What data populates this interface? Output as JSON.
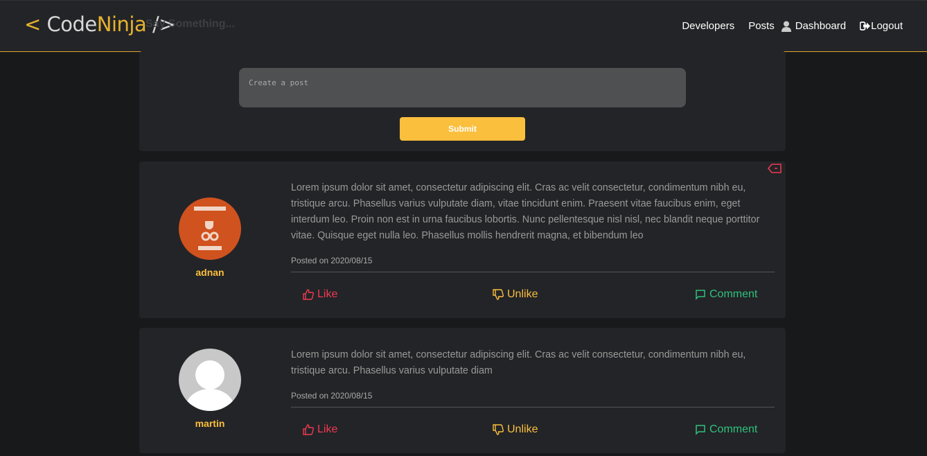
{
  "nav": {
    "logo_open": "< ",
    "logo_code": "Code",
    "logo_ninja": "Ninja",
    "logo_close": " />",
    "tagline": "Say Something...",
    "links": [
      "Developers",
      "Posts",
      "Dashboard",
      "Logout"
    ]
  },
  "create": {
    "placeholder": "Create a post",
    "submit": "Submit"
  },
  "colors": {
    "accent": "#fbbf3e",
    "like": "#f03a54",
    "comment": "#2ec27e"
  },
  "posts": [
    {
      "user": "adnan",
      "avatar": "programmer-code-badge",
      "text": "Lorem ipsum dolor sit amet, consectetur adipiscing elit. Cras ac velit consectetur, condimentum nibh eu, tristique arcu. Phasellus varius vulputate diam, vitae tincidunt enim. Praesent vitae faucibus enim, eget interdum leo. Proin non est in urna faucibus lobortis. Nunc pellentesque nisl nisl, nec blandit neque porttitor vitae. Quisque eget nulla leo. Phasellus mollis hendrerit magna, et bibendum leo",
      "date": "Posted on 2020/08/15",
      "like": "Like",
      "unlike": "Unlike",
      "comment": "Comment"
    },
    {
      "user": "martin",
      "avatar": "default-user",
      "text": "Lorem ipsum dolor sit amet, consectetur adipiscing elit. Cras ac velit consectetur, condimentum nibh eu, tristique arcu. Phasellus varius vulputate diam",
      "date": "Posted on 2020/08/15",
      "like": "Like",
      "unlike": "Unlike",
      "comment": "Comment"
    }
  ]
}
